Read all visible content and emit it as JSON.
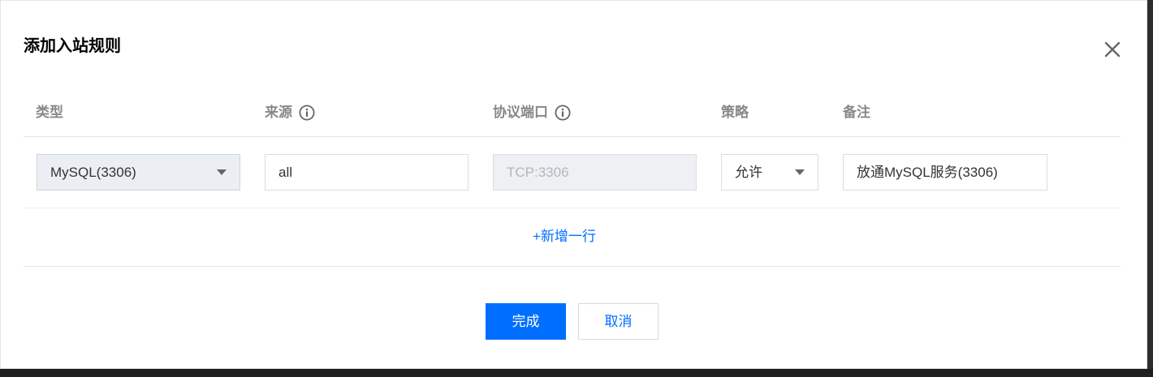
{
  "dialog": {
    "title": "添加入站规则",
    "close_icon": "close-icon"
  },
  "table": {
    "headers": {
      "type": "类型",
      "source": "来源",
      "protocol_port": "协议端口",
      "policy": "策略",
      "remark": "备注"
    },
    "info_icon": "info-icon",
    "rows": [
      {
        "type": "MySQL(3306)",
        "source": "all",
        "protocol_port": "TCP:3306",
        "policy": "允许",
        "remark": "放通MySQL服务(3306)"
      }
    ],
    "add_row_label": "+新增一行"
  },
  "footer": {
    "confirm_label": "完成",
    "cancel_label": "取消"
  },
  "colors": {
    "primary": "#006eff",
    "header_text": "#888888",
    "border": "#e5e5e5"
  }
}
